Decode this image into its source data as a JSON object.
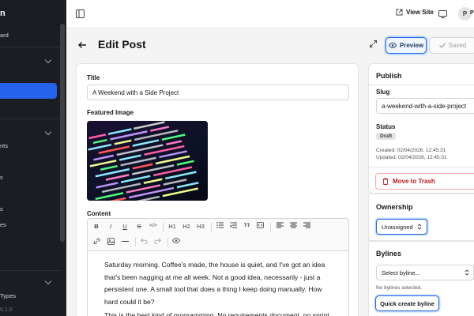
{
  "sidebar": {
    "brand": "n",
    "items": [
      {
        "label": "ard"
      },
      {
        "label": "nts"
      },
      {
        "label": "s"
      },
      {
        "label": "s"
      },
      {
        "label": "es"
      }
    ],
    "footer_item": "Types",
    "version": "0.1.0"
  },
  "topbar": {
    "view_site": "View Site",
    "avatar_initial": "P",
    "avatar_name": "P"
  },
  "header": {
    "title": "Edit Post",
    "preview_label": "Preview",
    "saved_label": "Saved"
  },
  "editor": {
    "title_label": "Title",
    "title_value": "A Weekend with a Side Project",
    "featured_label": "Featured Image",
    "content_label": "Content",
    "toolbar": [
      "B",
      "I",
      "U",
      "S",
      "</>",
      "H1",
      "H2",
      "H3"
    ],
    "paragraphs": [
      "Saturday morning. Coffee's made, the house is quiet, and I've got an idea that's been nagging at me all week. Not a good idea, necessarily - just a persistent one. A small tool that does a thing I keep doing manually. How hard could it be?",
      "This is the best kind of programming. No requirements document, no sprint"
    ]
  },
  "publish": {
    "title": "Publish",
    "slug_label": "Slug",
    "slug_value": "a-weekend-with-a-side-project",
    "status_label": "Status",
    "status_value": "Draft",
    "created": "Created: 02/04/2026, 12:45:31",
    "updated": "Updated: 02/04/2026, 12:45:31",
    "trash_label": "Move to Trash"
  },
  "ownership": {
    "title": "Ownership",
    "value": "Unassigned"
  },
  "bylines": {
    "title": "Bylines",
    "select_placeholder": "Select byline...",
    "empty_text": "No bylines selected.",
    "quick_create": "Quick create byline"
  },
  "colors": {
    "accent": "#2563eb",
    "sidebar_bg": "#1c1d22",
    "danger": "#b91c1c"
  }
}
